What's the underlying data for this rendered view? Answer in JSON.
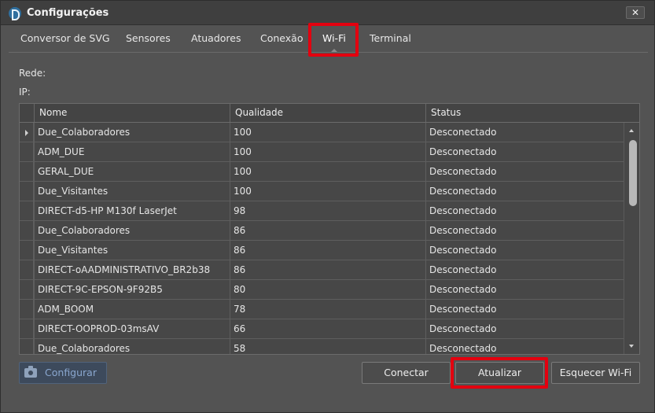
{
  "window": {
    "title": "Configurações",
    "close_glyph": "✕"
  },
  "tabs": [
    {
      "label": "Conversor de SVG",
      "active": false
    },
    {
      "label": "Sensores",
      "active": false
    },
    {
      "label": "Atuadores",
      "active": false
    },
    {
      "label": "Conexão",
      "active": false
    },
    {
      "label": "Wi-Fi",
      "active": true
    },
    {
      "label": "Terminal",
      "active": false
    }
  ],
  "info": {
    "network_label": "Rede:",
    "ip_label": "IP:"
  },
  "table": {
    "columns": [
      "Nome",
      "Qualidade",
      "Status"
    ],
    "rows": [
      {
        "name": "Due_Colaboradores",
        "quality": "100",
        "status": "Desconectado",
        "current": true
      },
      {
        "name": "ADM_DUE",
        "quality": "100",
        "status": "Desconectado"
      },
      {
        "name": "GERAL_DUE",
        "quality": "100",
        "status": "Desconectado"
      },
      {
        "name": "Due_Visitantes",
        "quality": "100",
        "status": "Desconectado"
      },
      {
        "name": "DIRECT-d5-HP M130f LaserJet",
        "quality": "98",
        "status": "Desconectado"
      },
      {
        "name": "Due_Colaboradores",
        "quality": "86",
        "status": "Desconectado"
      },
      {
        "name": "Due_Visitantes",
        "quality": "86",
        "status": "Desconectado"
      },
      {
        "name": "DIRECT-oAADMINISTRATIVO_BR2b38",
        "quality": "86",
        "status": "Desconectado"
      },
      {
        "name": "DIRECT-9C-EPSON-9F92B5",
        "quality": "80",
        "status": "Desconectado"
      },
      {
        "name": "ADM_BOOM",
        "quality": "78",
        "status": "Desconectado"
      },
      {
        "name": "DIRECT-OOPROD-03msAV",
        "quality": "66",
        "status": "Desconectado"
      },
      {
        "name": "Due_Colaboradores",
        "quality": "58",
        "status": "Desconectado"
      }
    ]
  },
  "buttons": {
    "configure": "Configurar",
    "connect": "Conectar",
    "refresh": "Atualizar",
    "forget": "Esquecer Wi-Fi"
  },
  "colors": {
    "highlight": "#e3000f",
    "window_bg": "#535353",
    "disabled_button_text": "#8aa7cf"
  }
}
